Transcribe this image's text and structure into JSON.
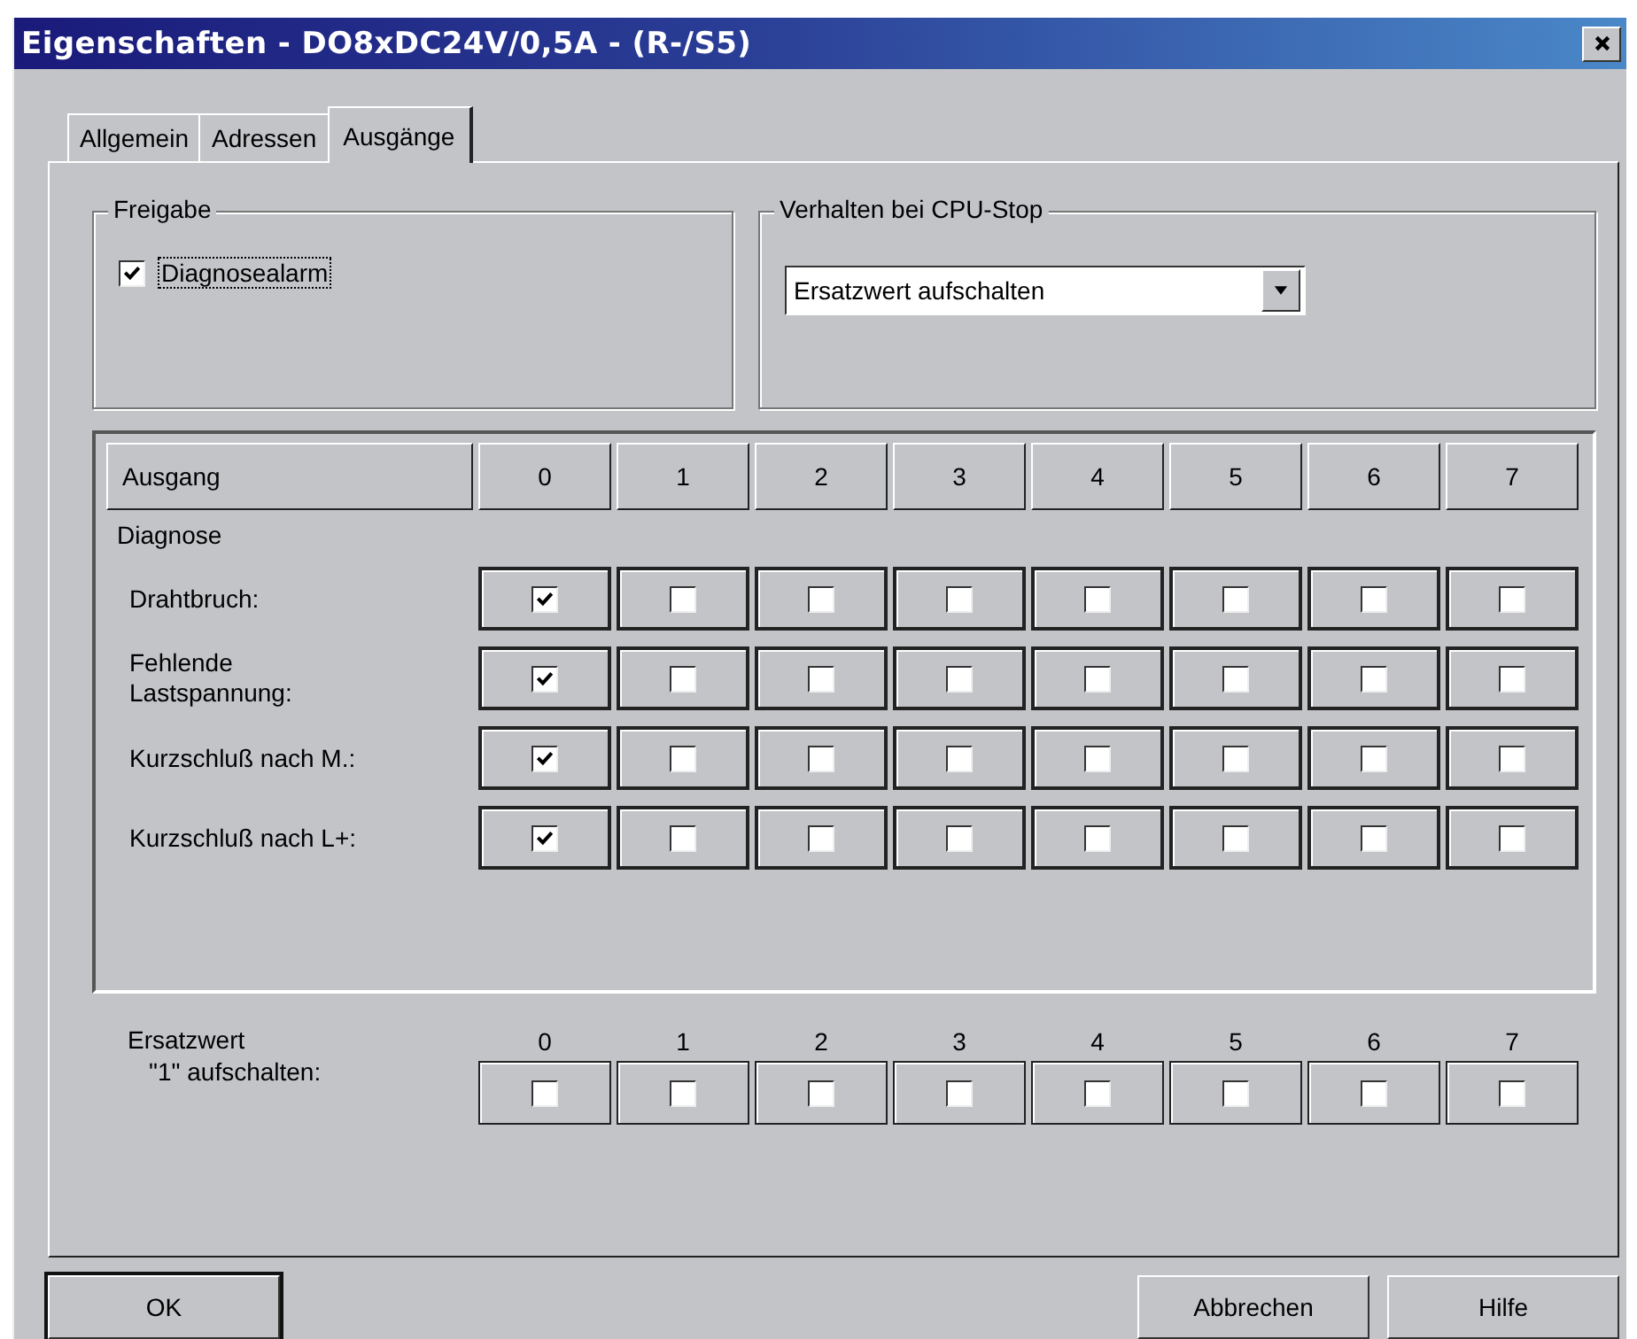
{
  "window": {
    "title": "Eigenschaften - DO8xDC24V/0,5A - (R-/S5)"
  },
  "tabs": [
    {
      "label": "Allgemein",
      "selected": false
    },
    {
      "label": "Adressen",
      "selected": false
    },
    {
      "label": "Ausgänge",
      "selected": true
    }
  ],
  "freigabe": {
    "title": "Freigabe",
    "checkbox": {
      "label": "Diagnosealarm",
      "checked": true
    }
  },
  "cpu_stop": {
    "title": "Verhalten bei CPU-Stop",
    "dropdown": {
      "value": "Ersatzwert aufschalten"
    }
  },
  "outputs_table": {
    "header": "Ausgang",
    "columns": [
      "0",
      "1",
      "2",
      "3",
      "4",
      "5",
      "6",
      "7"
    ],
    "section": "Diagnose",
    "rows": [
      {
        "label": "Drahtbruch:",
        "checks": [
          {
            "checked": true
          },
          {
            "checked": false
          },
          {
            "checked": false
          },
          {
            "checked": false
          },
          {
            "checked": false
          },
          {
            "checked": false
          },
          {
            "checked": false
          },
          {
            "checked": false
          }
        ]
      },
      {
        "label": "Fehlende\nLastspannung:",
        "checks": [
          {
            "checked": true
          },
          {
            "checked": false
          },
          {
            "checked": false
          },
          {
            "checked": false
          },
          {
            "checked": false
          },
          {
            "checked": false
          },
          {
            "checked": false
          },
          {
            "checked": false
          }
        ]
      },
      {
        "label": "Kurzschluß nach M.:",
        "checks": [
          {
            "checked": true
          },
          {
            "checked": false
          },
          {
            "checked": false
          },
          {
            "checked": false
          },
          {
            "checked": false
          },
          {
            "checked": false
          },
          {
            "checked": false
          },
          {
            "checked": false
          }
        ]
      },
      {
        "label": "Kurzschluß nach L+:",
        "checks": [
          {
            "checked": true
          },
          {
            "checked": false
          },
          {
            "checked": false
          },
          {
            "checked": false
          },
          {
            "checked": false
          },
          {
            "checked": false
          },
          {
            "checked": false
          },
          {
            "checked": false
          }
        ]
      }
    ]
  },
  "ersatzwert": {
    "label_lines": [
      "Ersatzwert",
      "\"1\" aufschalten:"
    ],
    "columns": [
      "0",
      "1",
      "2",
      "3",
      "4",
      "5",
      "6",
      "7"
    ],
    "checks": [
      {
        "checked": false
      },
      {
        "checked": false
      },
      {
        "checked": false
      },
      {
        "checked": false
      },
      {
        "checked": false
      },
      {
        "checked": false
      },
      {
        "checked": false
      },
      {
        "checked": false
      }
    ]
  },
  "buttons": [
    {
      "label": "OK",
      "default": true
    },
    {
      "label": "Abbrechen",
      "default": false
    },
    {
      "label": "Hilfe",
      "default": false
    }
  ]
}
